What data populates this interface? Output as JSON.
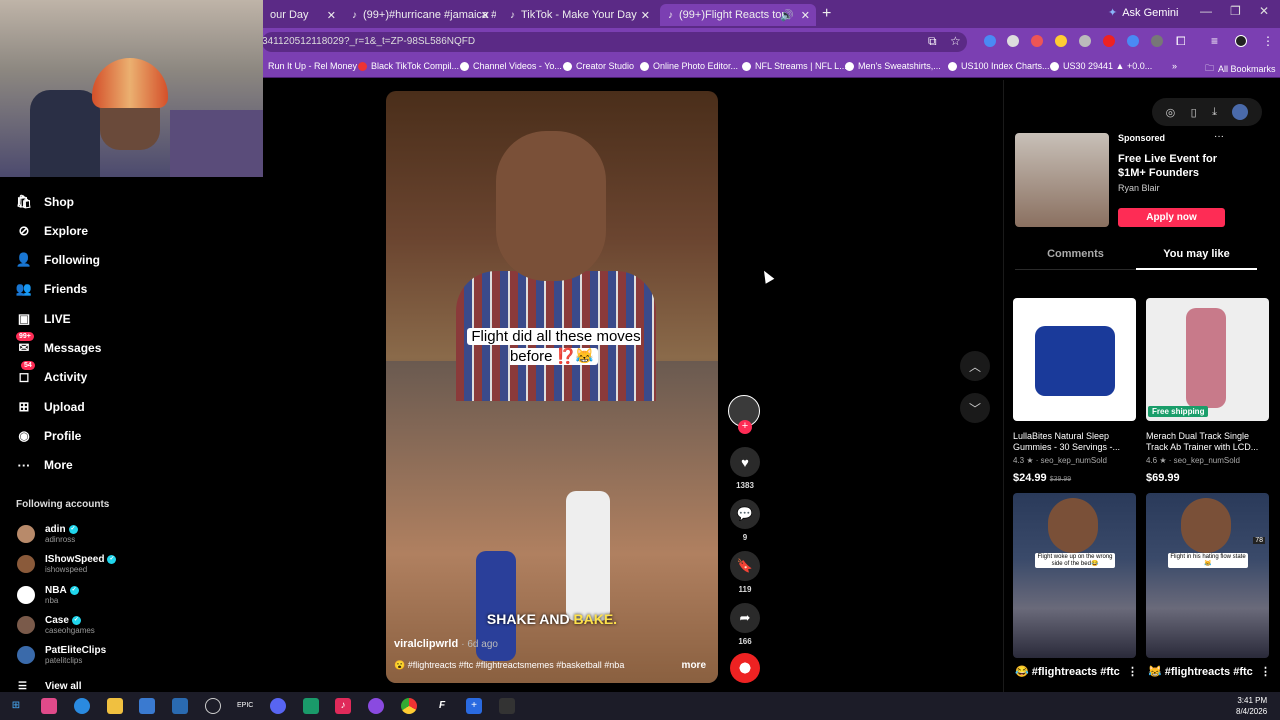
{
  "browser": {
    "tabs": [
      {
        "label": "our Day"
      },
      {
        "label": "(99+)#hurricane #jamaica #wea"
      },
      {
        "label": "TikTok - Make Your Day"
      },
      {
        "label": "(99+)Flight Reacts top 100 ("
      }
    ],
    "new_tab": "+",
    "gemini": "Ask Gemini",
    "url": "341120512118029?_r=1&_t=ZP-98SL586NQFD",
    "all_bookmarks": "All Bookmarks",
    "bookmarks": [
      "Run It Up - Rel Money",
      "Black TikTok Compil...",
      "Channel Videos - Yo...",
      "Creator Studio",
      "Online Photo Editor...",
      "NFL Streams | NFL L...",
      "Men's Sweatshirts,...",
      "US100 Index Charts...",
      "US30 29441 ▲ +0.0..."
    ]
  },
  "sidebar": {
    "items": [
      {
        "label": "Shop",
        "icon": "shop-icon"
      },
      {
        "label": "Explore",
        "icon": "explore-icon"
      },
      {
        "label": "Following",
        "icon": "following-icon"
      },
      {
        "label": "Friends",
        "icon": "friends-icon"
      },
      {
        "label": "LIVE",
        "icon": "live-icon"
      },
      {
        "label": "Messages",
        "icon": "messages-icon",
        "badge": "99+"
      },
      {
        "label": "Activity",
        "icon": "activity-icon",
        "badge": "54"
      },
      {
        "label": "Upload",
        "icon": "upload-icon"
      },
      {
        "label": "Profile",
        "icon": "profile-icon"
      },
      {
        "label": "More",
        "icon": "more-icon"
      }
    ],
    "following_title": "Following accounts",
    "accounts": [
      {
        "name": "adin",
        "handle": "adinross",
        "color": "#b88a6a"
      },
      {
        "name": "IShowSpeed",
        "handle": "ishowspeed",
        "color": "#8a5a3a"
      },
      {
        "name": "NBA",
        "handle": "nba",
        "color": "#ffffff"
      },
      {
        "name": "Case",
        "handle": "caseohgames",
        "color": "#7a5a4a"
      },
      {
        "name": "PatEliteClips",
        "handle": "patelitclips",
        "color": "#3a6aaa"
      }
    ],
    "view_all": "View all"
  },
  "video": {
    "caption": "Flight did all these moves before ⁉️😹",
    "overlay": "SHAKE AND",
    "overlay_highlight": "BAKE.",
    "author": "viralclipwrld",
    "age": "· 6d ago",
    "tags": "😮 #flightreacts #ftc #flightreactsmemes #basketball #nba",
    "more": "more",
    "likes": "1383",
    "comments": "9",
    "saves": "119",
    "shares": "166"
  },
  "right": {
    "sponsored": "Sponsored",
    "ad_title": "Free Live Event for $1M+ Founders",
    "ad_author": "Ryan Blair",
    "ad_button": "Apply now",
    "tab_comments": "Comments",
    "tab_you_may_like": "You may like",
    "products": [
      {
        "title": "LullaBites Natural Sleep Gummies - 30 Servings -...",
        "rating": "4.3 ★ · seo_kep_numSold",
        "price": "$24.99",
        "old_price": "$39.99"
      },
      {
        "title": "Merach Dual Track Single Track Ab Trainer with LCD...",
        "rating": "4.6 ★ · seo_kep_numSold",
        "price": "$69.99",
        "badge": "Free shipping"
      }
    ],
    "videos": [
      {
        "bubble": "Flight woke up on the wrong side of the bed😂",
        "label": "😂 #flightreacts #ftc"
      },
      {
        "bubble": "Flight in his hating flow state😹",
        "label": "😹 #flightreacts #ftc",
        "num": "78"
      }
    ]
  },
  "taskbar": {
    "time": "3:41 PM",
    "date": "8/4/2026"
  },
  "colors": {
    "accent": "#fe2c55",
    "chrome_purple": "#7b3fb2"
  }
}
